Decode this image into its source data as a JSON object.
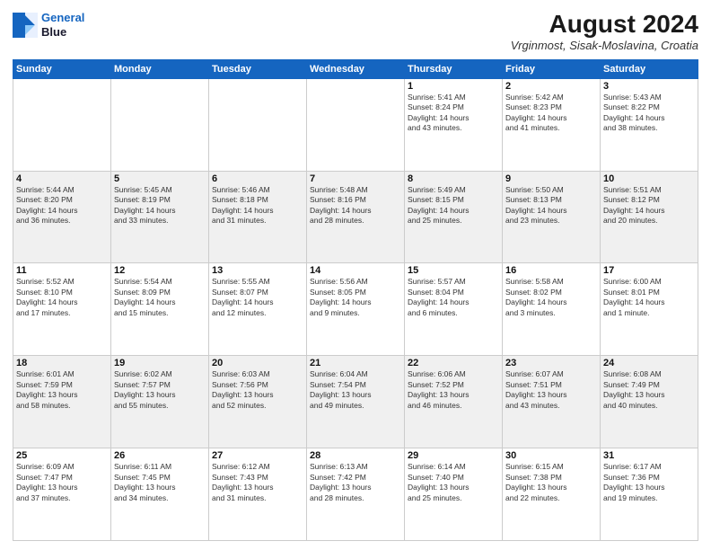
{
  "header": {
    "logo": {
      "line1": "General",
      "line2": "Blue"
    },
    "title": "August 2024",
    "subtitle": "Vrginmost, Sisak-Moslavina, Croatia"
  },
  "weekdays": [
    "Sunday",
    "Monday",
    "Tuesday",
    "Wednesday",
    "Thursday",
    "Friday",
    "Saturday"
  ],
  "weeks": [
    [
      {
        "day": "",
        "info": ""
      },
      {
        "day": "",
        "info": ""
      },
      {
        "day": "",
        "info": ""
      },
      {
        "day": "",
        "info": ""
      },
      {
        "day": "1",
        "info": "Sunrise: 5:41 AM\nSunset: 8:24 PM\nDaylight: 14 hours\nand 43 minutes."
      },
      {
        "day": "2",
        "info": "Sunrise: 5:42 AM\nSunset: 8:23 PM\nDaylight: 14 hours\nand 41 minutes."
      },
      {
        "day": "3",
        "info": "Sunrise: 5:43 AM\nSunset: 8:22 PM\nDaylight: 14 hours\nand 38 minutes."
      }
    ],
    [
      {
        "day": "4",
        "info": "Sunrise: 5:44 AM\nSunset: 8:20 PM\nDaylight: 14 hours\nand 36 minutes."
      },
      {
        "day": "5",
        "info": "Sunrise: 5:45 AM\nSunset: 8:19 PM\nDaylight: 14 hours\nand 33 minutes."
      },
      {
        "day": "6",
        "info": "Sunrise: 5:46 AM\nSunset: 8:18 PM\nDaylight: 14 hours\nand 31 minutes."
      },
      {
        "day": "7",
        "info": "Sunrise: 5:48 AM\nSunset: 8:16 PM\nDaylight: 14 hours\nand 28 minutes."
      },
      {
        "day": "8",
        "info": "Sunrise: 5:49 AM\nSunset: 8:15 PM\nDaylight: 14 hours\nand 25 minutes."
      },
      {
        "day": "9",
        "info": "Sunrise: 5:50 AM\nSunset: 8:13 PM\nDaylight: 14 hours\nand 23 minutes."
      },
      {
        "day": "10",
        "info": "Sunrise: 5:51 AM\nSunset: 8:12 PM\nDaylight: 14 hours\nand 20 minutes."
      }
    ],
    [
      {
        "day": "11",
        "info": "Sunrise: 5:52 AM\nSunset: 8:10 PM\nDaylight: 14 hours\nand 17 minutes."
      },
      {
        "day": "12",
        "info": "Sunrise: 5:54 AM\nSunset: 8:09 PM\nDaylight: 14 hours\nand 15 minutes."
      },
      {
        "day": "13",
        "info": "Sunrise: 5:55 AM\nSunset: 8:07 PM\nDaylight: 14 hours\nand 12 minutes."
      },
      {
        "day": "14",
        "info": "Sunrise: 5:56 AM\nSunset: 8:05 PM\nDaylight: 14 hours\nand 9 minutes."
      },
      {
        "day": "15",
        "info": "Sunrise: 5:57 AM\nSunset: 8:04 PM\nDaylight: 14 hours\nand 6 minutes."
      },
      {
        "day": "16",
        "info": "Sunrise: 5:58 AM\nSunset: 8:02 PM\nDaylight: 14 hours\nand 3 minutes."
      },
      {
        "day": "17",
        "info": "Sunrise: 6:00 AM\nSunset: 8:01 PM\nDaylight: 14 hours\nand 1 minute."
      }
    ],
    [
      {
        "day": "18",
        "info": "Sunrise: 6:01 AM\nSunset: 7:59 PM\nDaylight: 13 hours\nand 58 minutes."
      },
      {
        "day": "19",
        "info": "Sunrise: 6:02 AM\nSunset: 7:57 PM\nDaylight: 13 hours\nand 55 minutes."
      },
      {
        "day": "20",
        "info": "Sunrise: 6:03 AM\nSunset: 7:56 PM\nDaylight: 13 hours\nand 52 minutes."
      },
      {
        "day": "21",
        "info": "Sunrise: 6:04 AM\nSunset: 7:54 PM\nDaylight: 13 hours\nand 49 minutes."
      },
      {
        "day": "22",
        "info": "Sunrise: 6:06 AM\nSunset: 7:52 PM\nDaylight: 13 hours\nand 46 minutes."
      },
      {
        "day": "23",
        "info": "Sunrise: 6:07 AM\nSunset: 7:51 PM\nDaylight: 13 hours\nand 43 minutes."
      },
      {
        "day": "24",
        "info": "Sunrise: 6:08 AM\nSunset: 7:49 PM\nDaylight: 13 hours\nand 40 minutes."
      }
    ],
    [
      {
        "day": "25",
        "info": "Sunrise: 6:09 AM\nSunset: 7:47 PM\nDaylight: 13 hours\nand 37 minutes."
      },
      {
        "day": "26",
        "info": "Sunrise: 6:11 AM\nSunset: 7:45 PM\nDaylight: 13 hours\nand 34 minutes."
      },
      {
        "day": "27",
        "info": "Sunrise: 6:12 AM\nSunset: 7:43 PM\nDaylight: 13 hours\nand 31 minutes."
      },
      {
        "day": "28",
        "info": "Sunrise: 6:13 AM\nSunset: 7:42 PM\nDaylight: 13 hours\nand 28 minutes."
      },
      {
        "day": "29",
        "info": "Sunrise: 6:14 AM\nSunset: 7:40 PM\nDaylight: 13 hours\nand 25 minutes."
      },
      {
        "day": "30",
        "info": "Sunrise: 6:15 AM\nSunset: 7:38 PM\nDaylight: 13 hours\nand 22 minutes."
      },
      {
        "day": "31",
        "info": "Sunrise: 6:17 AM\nSunset: 7:36 PM\nDaylight: 13 hours\nand 19 minutes."
      }
    ]
  ]
}
